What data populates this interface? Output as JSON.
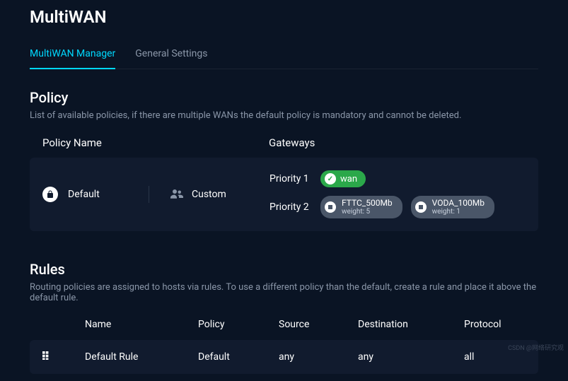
{
  "pageTitle": "MultiWAN",
  "tabs": {
    "manager": "MultiWAN Manager",
    "general": "General Settings"
  },
  "policySection": {
    "title": "Policy",
    "description": "List of available policies, if there are multiple WANs the default policy is mandatory and cannot be deleted.",
    "headerName": "Policy Name",
    "headerGateways": "Gateways"
  },
  "policy": {
    "name": "Default",
    "customLabel": "Custom",
    "priority1Label": "Priority 1",
    "priority2Label": "Priority 2",
    "wanBadge": "wan",
    "gateways": {
      "g1": {
        "name": "FTTC_500Mb",
        "weight": "weight: 5"
      },
      "g2": {
        "name": "VODA_100Mb",
        "weight": "weight: 1"
      }
    }
  },
  "rulesSection": {
    "title": "Rules",
    "description": "Routing policies are assigned to hosts via rules. To use a different policy than the default, create a rule and place it above the default rule.",
    "headers": {
      "name": "Name",
      "policy": "Policy",
      "source": "Source",
      "destination": "Destination",
      "protocol": "Protocol"
    }
  },
  "rule": {
    "name": "Default Rule",
    "policy": "Default",
    "source": "any",
    "destination": "any",
    "protocol": "all"
  },
  "watermark": "CSDN @网络研究观"
}
